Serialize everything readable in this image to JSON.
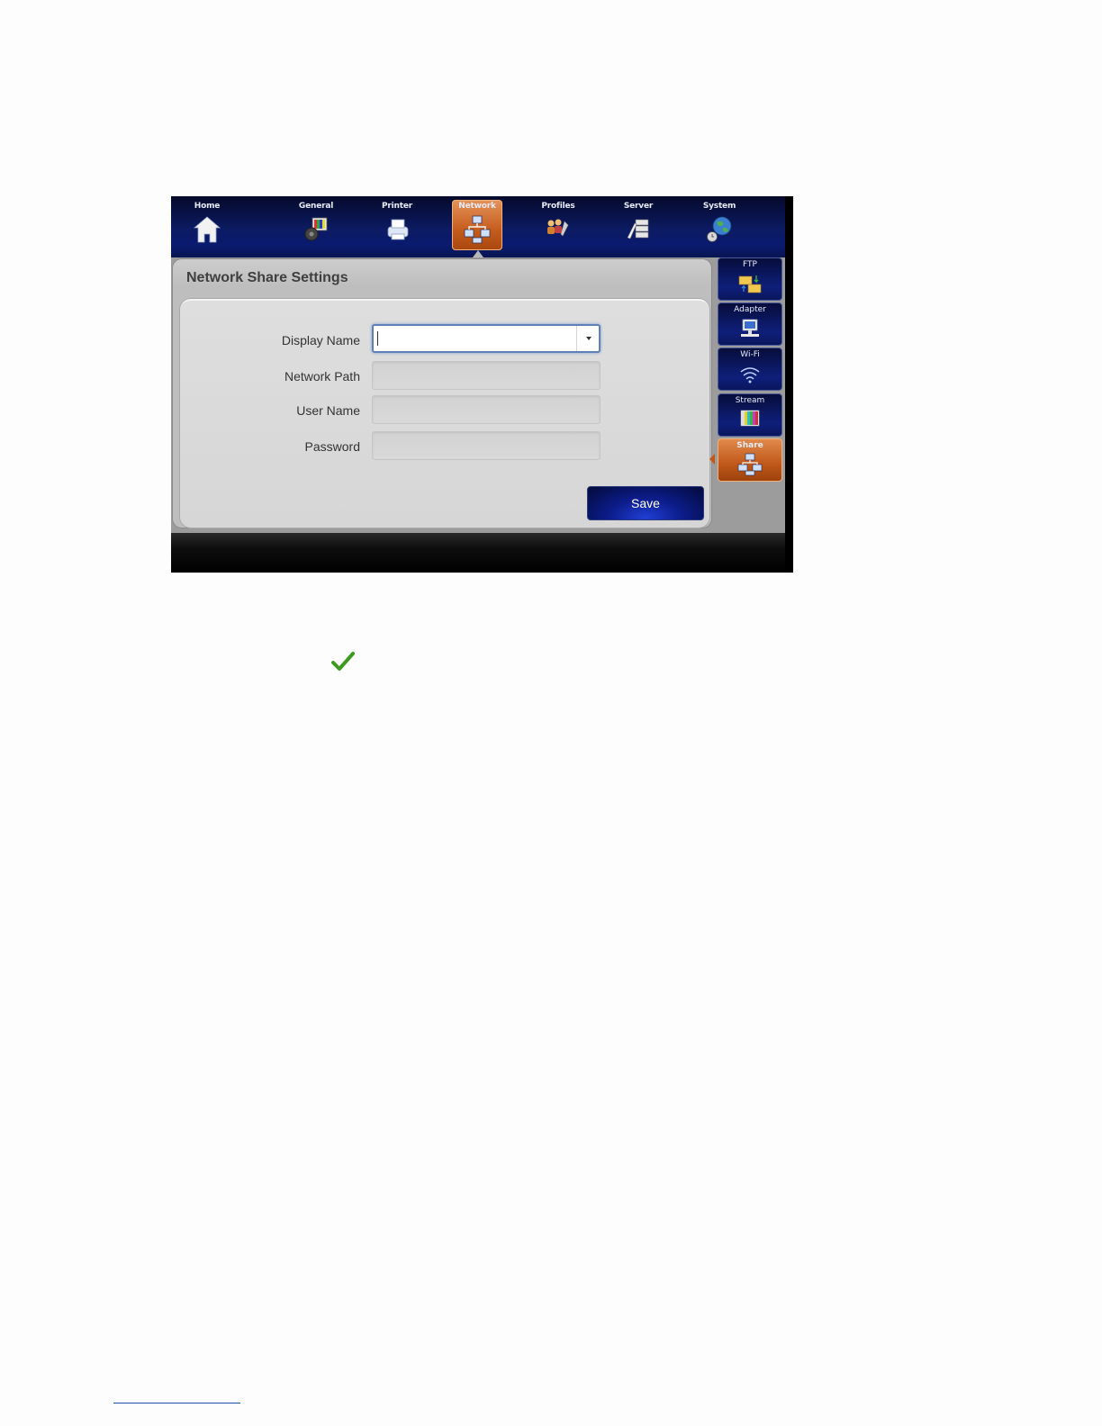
{
  "topnav": {
    "tabs": [
      {
        "label": "Home",
        "icon": "home-icon",
        "active": false
      },
      {
        "label": "General",
        "icon": "general-icon",
        "active": false
      },
      {
        "label": "Printer",
        "icon": "printer-icon",
        "active": false
      },
      {
        "label": "Network",
        "icon": "network-icon",
        "active": true
      },
      {
        "label": "Profiles",
        "icon": "profiles-icon",
        "active": false
      },
      {
        "label": "Server",
        "icon": "server-icon",
        "active": false
      },
      {
        "label": "System",
        "icon": "system-icon",
        "active": false
      }
    ]
  },
  "panel": {
    "title": "Network Share Settings",
    "fields": [
      {
        "label": "Display Name",
        "value": "",
        "type": "combo"
      },
      {
        "label": "Network Path",
        "value": "",
        "type": "text"
      },
      {
        "label": "User Name",
        "value": "",
        "type": "text"
      },
      {
        "label": "Password",
        "value": "",
        "type": "password"
      }
    ],
    "save_label": "Save"
  },
  "subnav": {
    "tabs": [
      {
        "label": "FTP",
        "icon": "ftp-icon",
        "active": false
      },
      {
        "label": "Adapter",
        "icon": "adapter-icon",
        "active": false
      },
      {
        "label": "Wi-Fi",
        "icon": "wifi-icon",
        "active": false
      },
      {
        "label": "Stream",
        "icon": "stream-icon",
        "active": false
      },
      {
        "label": "Share",
        "icon": "share-icon",
        "active": true
      }
    ]
  },
  "document": {
    "check_icon": "check-icon",
    "check_color": "#3d9a1e"
  },
  "colors": {
    "nav_blue": "#0c1b63",
    "active_orange": "#c55c1d",
    "panel_gray": "#d6d6d6"
  }
}
